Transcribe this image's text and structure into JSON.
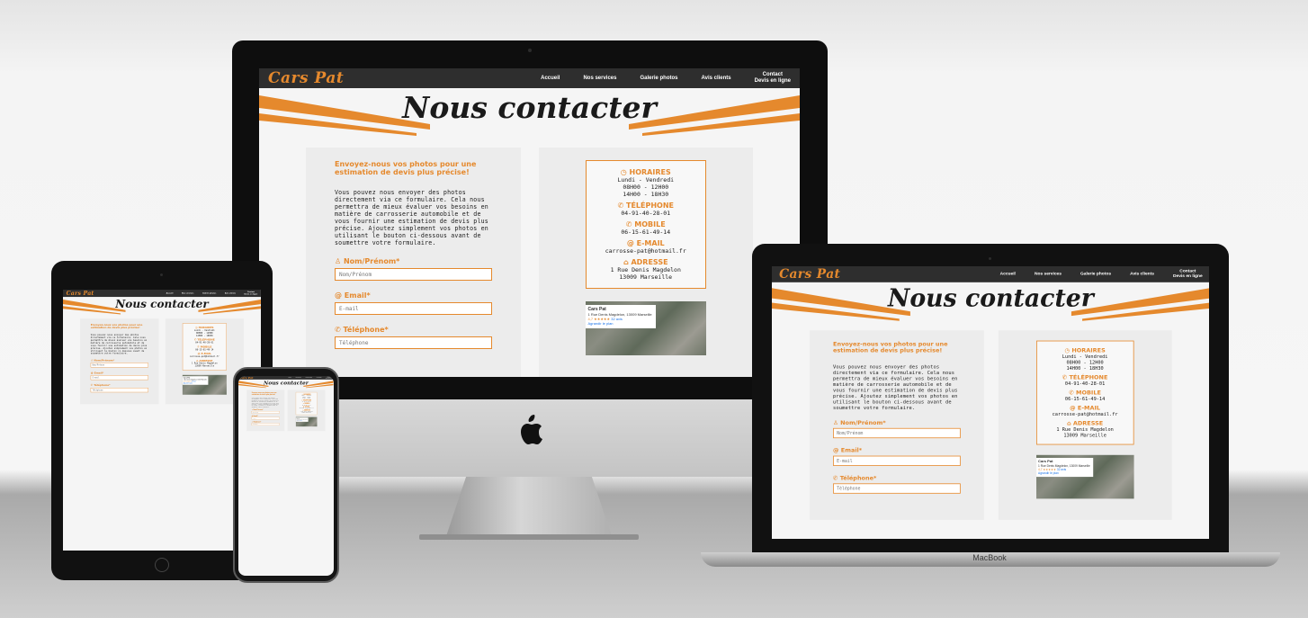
{
  "site": {
    "logo": "Cars Pat",
    "nav": [
      "Accueil",
      "Nos services",
      "Galerie photos",
      "Avis clients"
    ],
    "nav_cta_line1": "Contact",
    "nav_cta_line2": "Devis en ligne",
    "title": "Nous contacter",
    "intro_title": "Envoyez-nous vos photos pour une estimation de devis plus précise!",
    "intro_text": "Vous pouvez nous envoyer des photos directement via ce formulaire. Cela nous permettra de mieux évaluer vos besoins en matière de carrosserie automobile et de vous fournir une estimation de devis plus précise. Ajoutez simplement vos photos en utilisant le bouton ci-dessous avant de soumettre votre formulaire.",
    "fields": [
      {
        "label": "Nom/Prénom*",
        "placeholder": "Nom/Prénom",
        "icon": "user-icon"
      },
      {
        "label": "Email*",
        "placeholder": "E-mail",
        "icon": "at-icon"
      },
      {
        "label": "Téléphone*",
        "placeholder": "Téléphone",
        "icon": "phone-icon"
      }
    ],
    "contact": {
      "hours_title": "HORAIRES",
      "hours": [
        "Lundi - Vendredi",
        "08H00 - 12H00",
        "14H00 - 18H30"
      ],
      "phone_title": "TÉLÉPHONE",
      "phone": "04-91-40-28-01",
      "mobile_title": "MOBILE",
      "mobile": "06-15-61-49-14",
      "email_title": "E-MAIL",
      "email": "carrosse-pat@hotmail.fr",
      "address_title": "ADRESSE",
      "address": [
        "1 Rue Denis Magdelon",
        "13009 Marseille"
      ]
    },
    "map": {
      "name": "Cars Pat",
      "address": "1 Rue Denis Magdelon, 13009 Marseille",
      "rating": "4,7 ★★★★★",
      "reviews": "32 avis",
      "link": "Agrandir le plan"
    }
  },
  "devices": {
    "laptop_label": "MacBook"
  },
  "colors": {
    "accent": "#e5892d",
    "nav_bg": "#2e2e2e",
    "page_bg": "#f5f5f5"
  }
}
